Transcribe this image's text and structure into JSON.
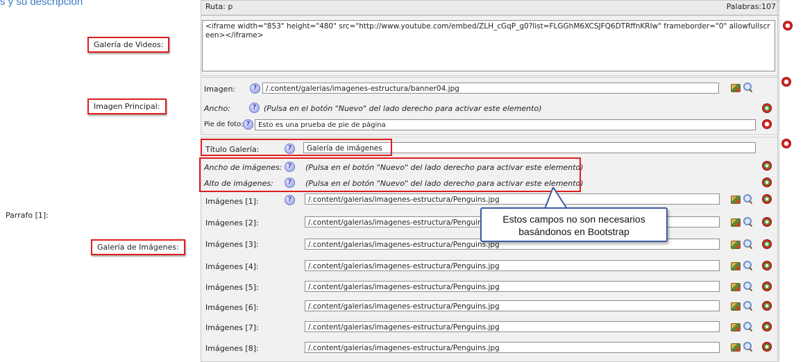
{
  "header": {
    "title": "s y su descripción"
  },
  "top_bar": {
    "ruta": "Ruta: p",
    "palabras": "Palabras:107"
  },
  "left": {
    "parrafo_label": "Parrafo [1]:"
  },
  "sections": {
    "videos": {
      "label": "Galería de Videos:",
      "embed_code": "<iframe width=\"853\" height=\"480\" src=\"http://www.youtube.com/embed/ZLH_cGqP_g0?list=FLGGhM6XCSJFQ6DTRffnKRIw\" frameborder=\"0\" allowfullscreen></iframe>"
    },
    "principal": {
      "label": "Imagen Principal:",
      "imagen_label": "Imagen:",
      "imagen_value": "/.content/galerias/imagenes-estructura/banner04.jpg",
      "ancho_label": "Ancho:",
      "ancho_note": "(Pulsa en el botón \"Nuevo\" del lado derecho para activar este elemento)",
      "pie_label": "Pie de foto:",
      "pie_value": "Esto es una prueba de pie de página"
    },
    "galeria": {
      "label": "Galería de Imágenes:",
      "titulo_label": "Título Galería:",
      "titulo_value": "Galería de imágenes",
      "ancho_label": "Ancho de imágenes:",
      "ancho_note": "(Pulsa en el botón \"Nuevo\" del lado derecho para activar este elemento)",
      "alto_label": "Alto de imágenes:",
      "alto_note": "(Pulsa en el botón \"Nuevo\" del lado derecho para activar este elemento)",
      "images": [
        {
          "label": "Imágenes [1]:",
          "value": "/.content/galerias/imagenes-estructura/Penguins.jpg"
        },
        {
          "label": "Imágenes [2]:",
          "value": "/.content/galerias/imagenes-estructura/Penguins.jpg"
        },
        {
          "label": "Imágenes [3]:",
          "value": "/.content/galerias/imagenes-estructura/Penguins.jpg"
        },
        {
          "label": "Imágenes [4]:",
          "value": "/.content/galerias/imagenes-estructura/Penguins.jpg"
        },
        {
          "label": "Imágenes [5]:",
          "value": "/.content/galerias/imagenes-estructura/Penguins.jpg"
        },
        {
          "label": "Imágenes [6]:",
          "value": "/.content/galerias/imagenes-estructura/Penguins.jpg"
        },
        {
          "label": "Imágenes [7]:",
          "value": "/.content/galerias/imagenes-estructura/Penguins.jpg"
        },
        {
          "label": "Imágenes [8]:",
          "value": "/.content/galerias/imagenes-estructura/Penguins.jpg"
        }
      ]
    }
  },
  "callout": {
    "line1": "Estos campos no son necesarios",
    "line2": "basándonos en Bootstrap"
  },
  "help_glyph": "?",
  "icons": {
    "help": "help-icon",
    "gallery": "gallery-icon",
    "search": "search-icon",
    "remove": "remove-element-icon",
    "add": "add-element-icon"
  },
  "colors": {
    "highlight": "#e01c1c",
    "callout_border": "#3e5a9e",
    "title": "#3b78c4"
  }
}
